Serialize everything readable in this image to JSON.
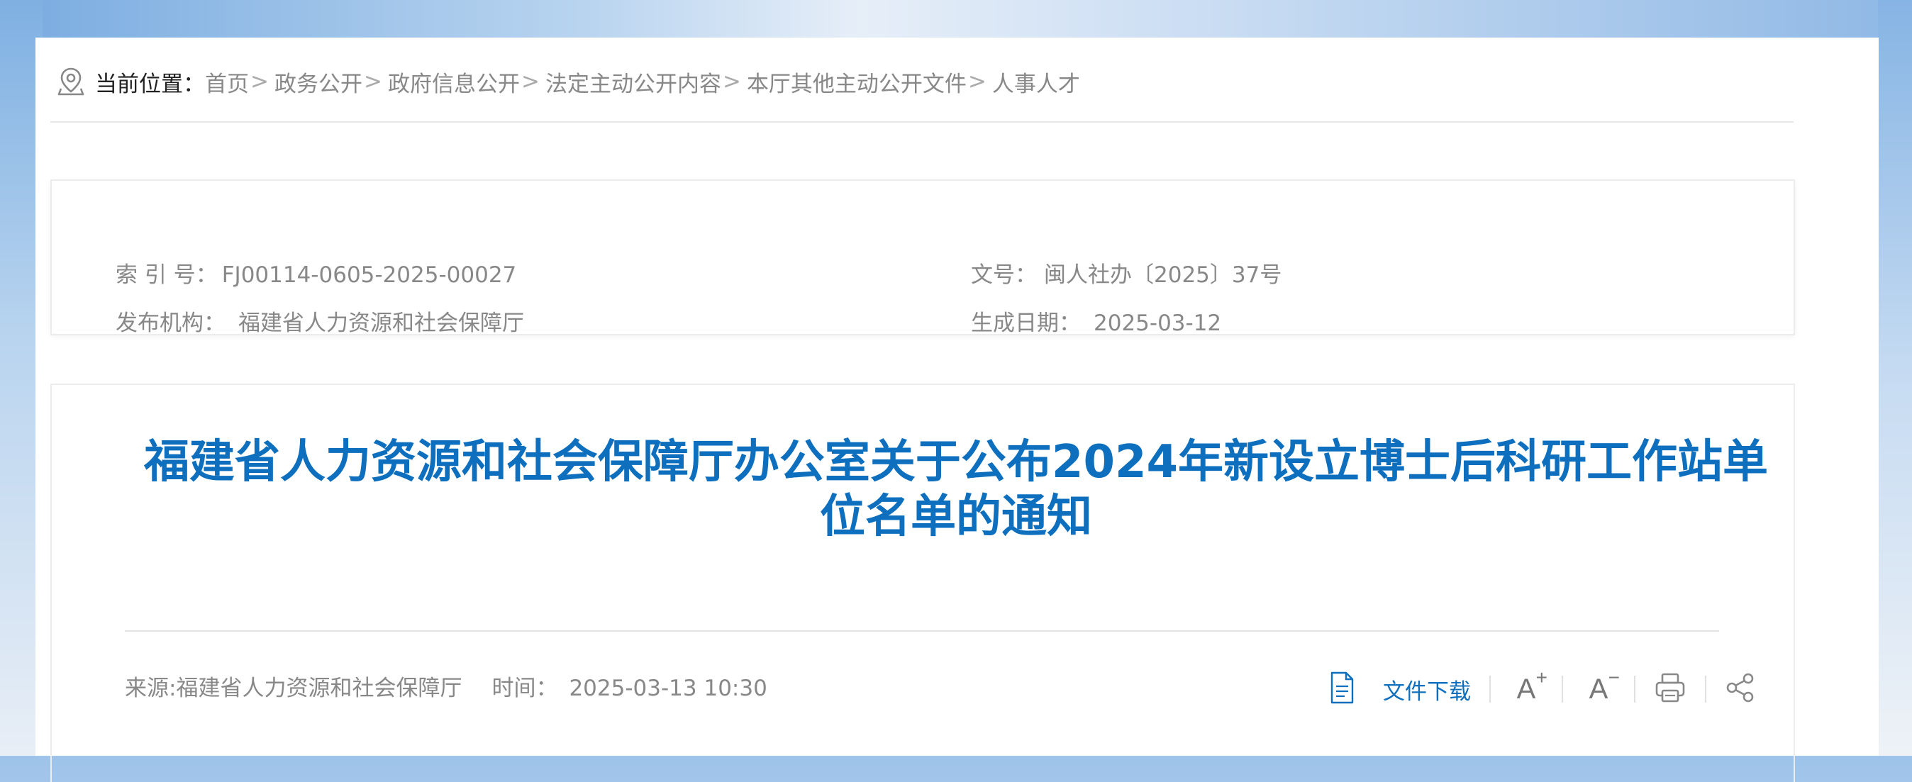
{
  "breadcrumb": {
    "label": "当前位置：",
    "items": [
      "首页",
      "政务公开",
      "政府信息公开",
      "法定主动公开内容",
      "本厅其他主动公开文件",
      "人事人才"
    ],
    "separator": ">"
  },
  "meta": {
    "index_label": "索 引 号：",
    "index_value": "FJ00114-0605-2025-00027",
    "docno_label": "文号：",
    "docno_value": "闽人社办〔2025〕37号",
    "publisher_label": "发布机构：",
    "publisher_value": "福建省人力资源和社会保障厅",
    "date_label": "生成日期：",
    "date_value": "2025-03-12"
  },
  "article": {
    "title_line1": "福建省人力资源和社会保障厅办公室关于公布2024年新设立博士后科研工作站单",
    "title_line2": "位名单的通知",
    "source": "来源:福建省人力资源和社会保障厅",
    "time_label": "时间：",
    "time_value": "2025-03-13 10:30"
  },
  "toolbar": {
    "download_label": "文件下载",
    "font_increase_label": "A",
    "font_decrease_label": "A"
  },
  "colors": {
    "accent": "#0d6fbd",
    "text_muted": "#888888"
  },
  "icons": [
    "location-pin-icon",
    "document-icon",
    "font-increase-icon",
    "font-decrease-icon",
    "print-icon",
    "share-icon"
  ]
}
